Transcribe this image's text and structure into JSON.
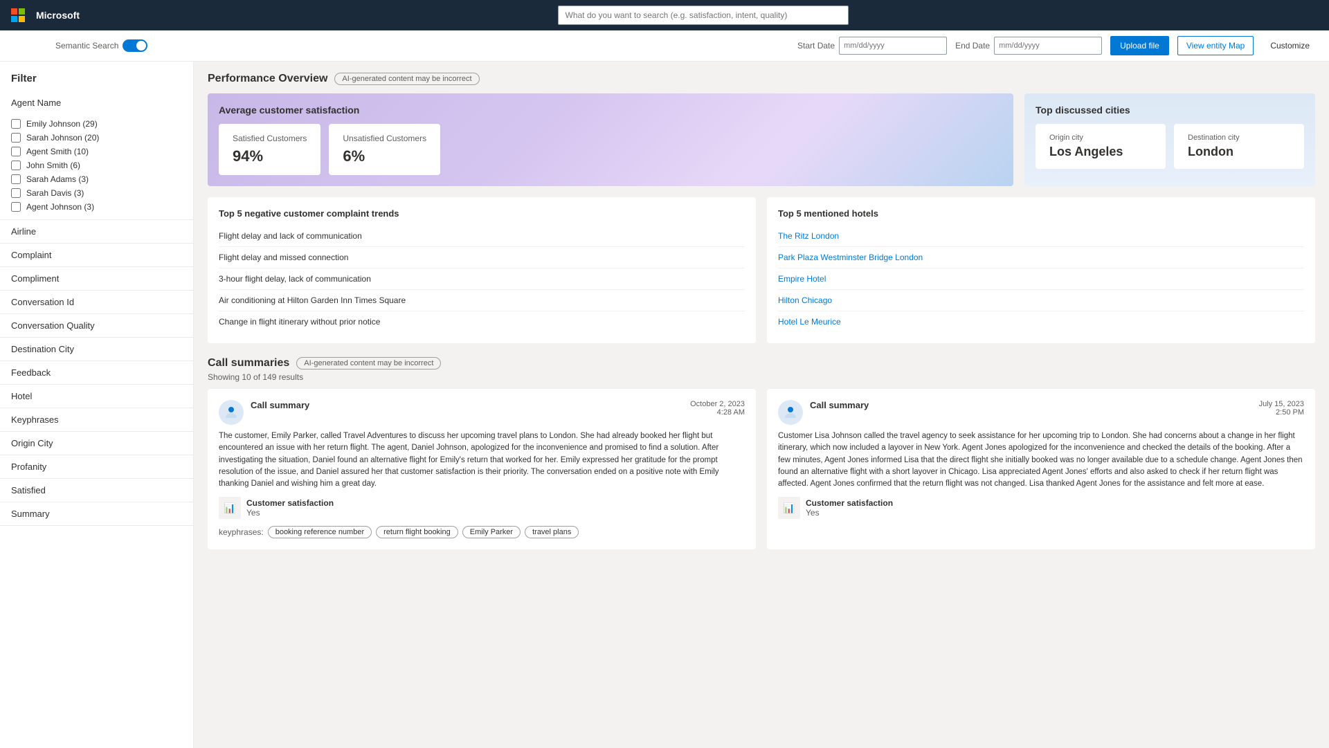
{
  "topnav": {
    "brand": "Microsoft",
    "search_placeholder": "What do you want to search (e.g. satisfaction, intent, quality)"
  },
  "controls": {
    "semantic_search_label": "Semantic Search",
    "start_date_label": "Start Date",
    "start_date_placeholder": "mm/dd/yyyy",
    "end_date_label": "End Date",
    "end_date_placeholder": "mm/dd/yyyy",
    "upload_btn": "Upload file",
    "entity_map_btn": "View entity Map",
    "customize_btn": "Customize"
  },
  "sidebar": {
    "title": "Filter",
    "sections": [
      {
        "name": "Agent Name",
        "agents": [
          "Emily Johnson (29)",
          "Sarah Johnson (20)",
          "Agent Smith (10)",
          "John Smith (6)",
          "Sarah Adams (3)",
          "Sarah Davis (3)",
          "Agent Johnson (3)"
        ]
      },
      {
        "name": "Airline"
      },
      {
        "name": "Complaint"
      },
      {
        "name": "Compliment"
      },
      {
        "name": "Conversation Id"
      },
      {
        "name": "Conversation Quality"
      },
      {
        "name": "Destination City"
      },
      {
        "name": "Feedback"
      },
      {
        "name": "Hotel"
      },
      {
        "name": "Keyphrases"
      },
      {
        "name": "Origin City"
      },
      {
        "name": "Profanity"
      },
      {
        "name": "Satisfied"
      },
      {
        "name": "Summary"
      }
    ]
  },
  "performance": {
    "title": "Performance Overview",
    "ai_badge": "AI-generated content may be incorrect",
    "satisfaction": {
      "title": "Average customer satisfaction",
      "satisfied_label": "Satisfied Customers",
      "satisfied_value": "94%",
      "unsatisfied_label": "Unsatisfied Customers",
      "unsatisfied_value": "6%"
    },
    "cities": {
      "title": "Top discussed cities",
      "origin_label": "Origin city",
      "origin_value": "Los Angeles",
      "destination_label": "Destination city",
      "destination_value": "London"
    },
    "complaints": {
      "title": "Top 5 negative customer complaint trends",
      "items": [
        "Flight delay and lack of communication",
        "Flight delay and missed connection",
        "3-hour flight delay, lack of communication",
        "Air conditioning at Hilton Garden Inn Times Square",
        "Change in flight itinerary without prior notice"
      ]
    },
    "hotels": {
      "title": "Top 5 mentioned hotels",
      "items": [
        "The Ritz London",
        "Park Plaza Westminster Bridge London",
        "Empire Hotel",
        "Hilton Chicago",
        "Hotel Le Meurice"
      ]
    }
  },
  "summaries": {
    "title": "Call summaries",
    "ai_badge": "AI-generated content may be incorrect",
    "showing_text": "Showing 10 of 149 results",
    "cards": [
      {
        "title": "Call summary",
        "date": "October 2, 2023",
        "time": "4:28 AM",
        "body": "The customer, Emily Parker, called Travel Adventures to discuss her upcoming travel plans to London. She had already booked her flight but encountered an issue with her return flight. The agent, Daniel Johnson, apologized for the inconvenience and promised to find a solution. After investigating the situation, Daniel found an alternative flight for Emily's return that worked for her. Emily expressed her gratitude for the prompt resolution of the issue, and Daniel assured her that customer satisfaction is their priority. The conversation ended on a positive note with Emily thanking Daniel and wishing him a great day.",
        "highlights": [
          "London",
          "return flight"
        ],
        "csat_label": "Customer satisfaction",
        "csat_value": "Yes",
        "keyphrases": [
          "booking reference number",
          "return flight booking",
          "Emily Parker",
          "travel plans"
        ]
      },
      {
        "title": "Call summary",
        "date": "July 15, 2023",
        "time": "2:50 PM",
        "body": "Customer Lisa Johnson called the travel agency to seek assistance for her upcoming trip to London. She had concerns about a change in her flight itinerary, which now included a layover in New York. Agent Jones apologized for the inconvenience and checked the details of the booking. After a few minutes, Agent Jones informed Lisa that the direct flight she initially booked was no longer available due to a schedule change. Agent Jones then found an alternative flight with a short layover in Chicago. Lisa appreciated Agent Jones' efforts and also asked to check if her return flight was affected. Agent Jones confirmed that the return flight was not changed. Lisa thanked Agent Jones for the assistance and felt more at ease.",
        "highlights": [
          "London",
          "New York",
          "Chicago"
        ],
        "csat_label": "Customer satisfaction",
        "csat_value": "Yes",
        "keyphrases": []
      }
    ]
  }
}
